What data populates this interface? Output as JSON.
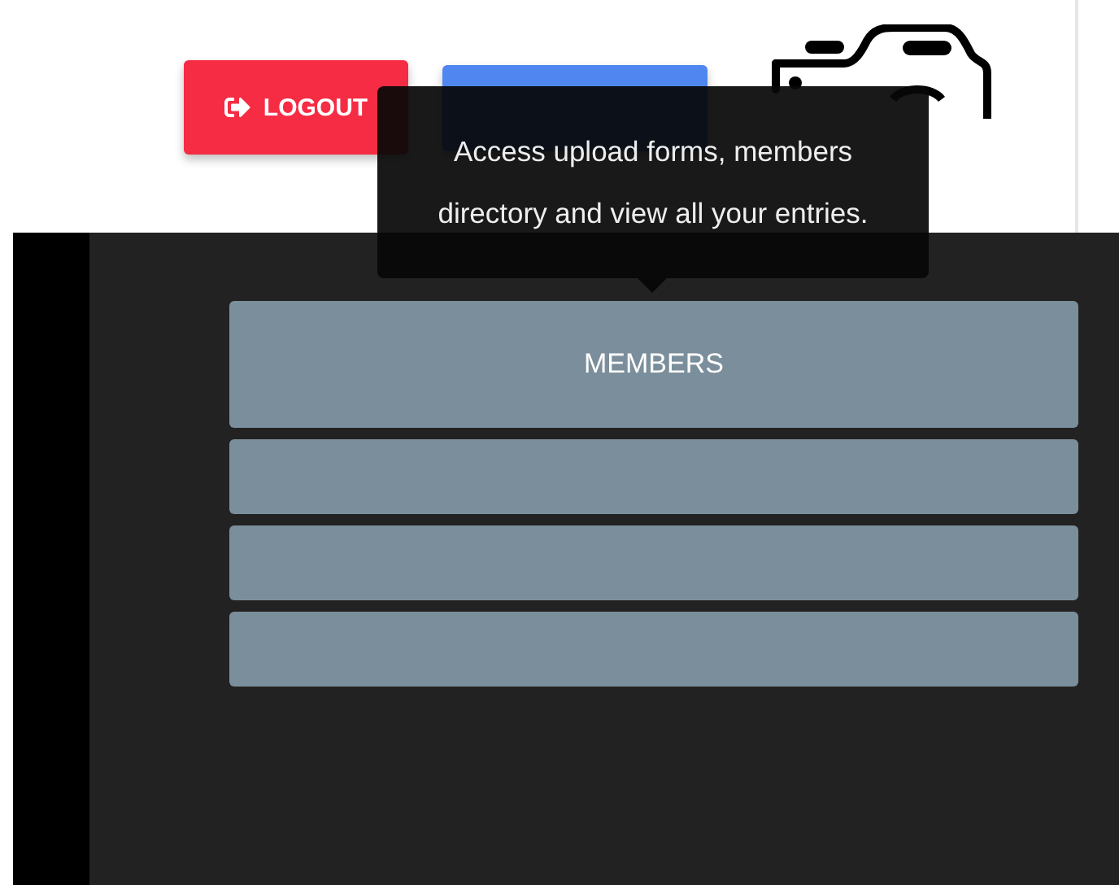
{
  "header": {
    "buttons": [
      {
        "label": "LOGOUT",
        "kind": "danger"
      },
      {
        "kind": "primary"
      }
    ]
  },
  "tooltip": {
    "text": "Access upload forms, members directory and view all your entries."
  },
  "menu": {
    "items": [
      {
        "kind": "labeled",
        "label": "MEMBERS"
      },
      {
        "kind": "blank"
      },
      {
        "kind": "blank"
      },
      {
        "kind": "blank"
      }
    ]
  }
}
